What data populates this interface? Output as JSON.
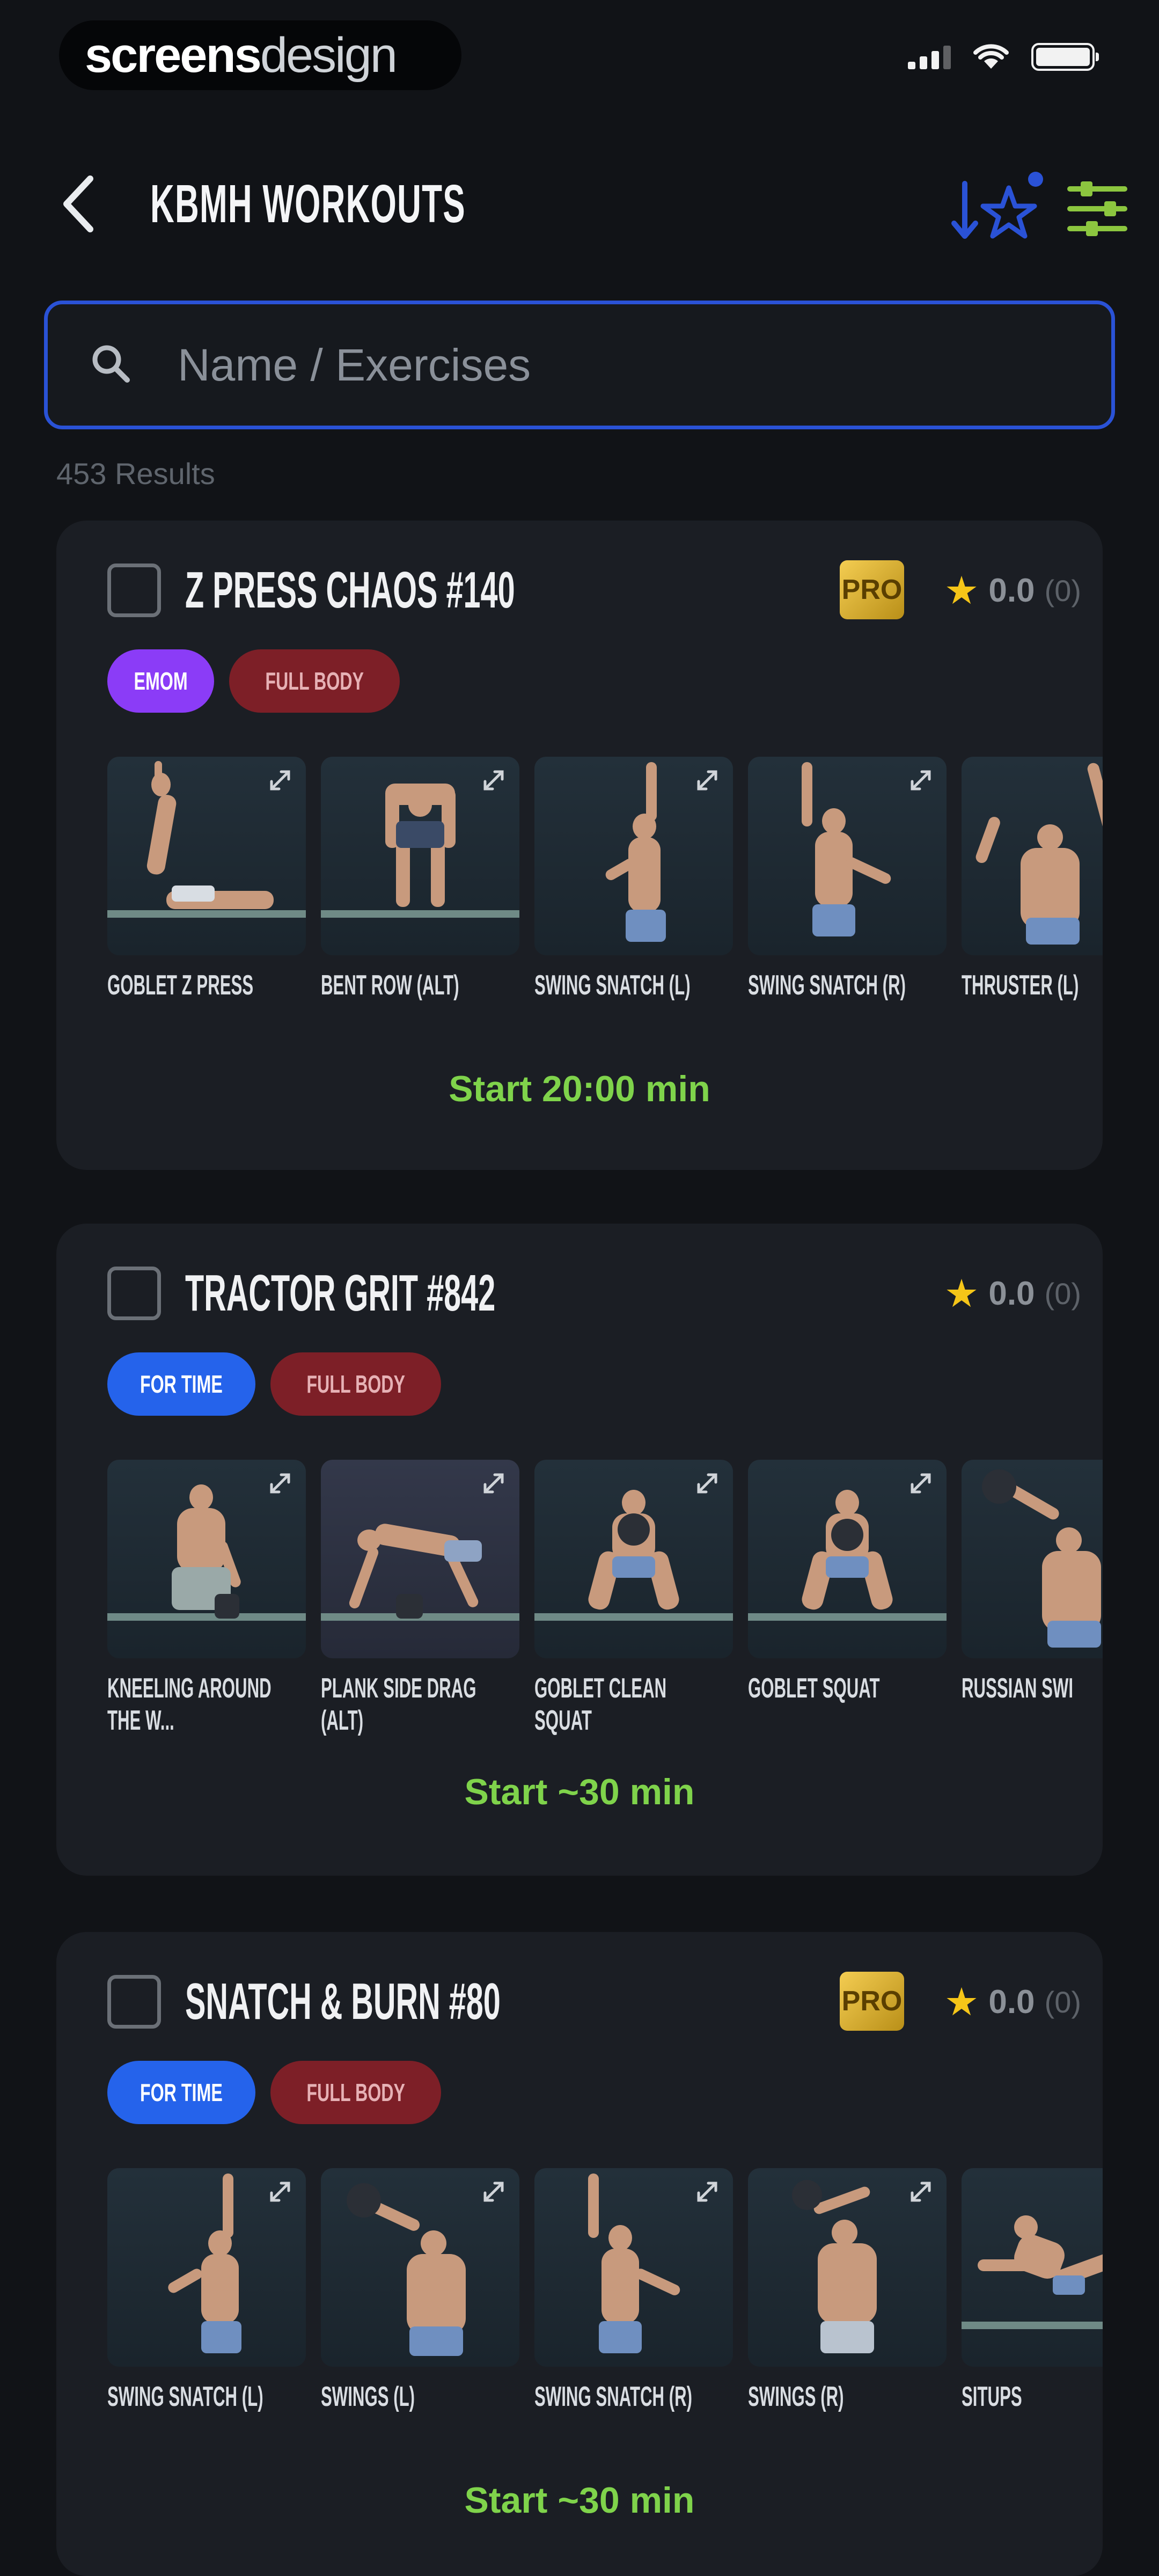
{
  "status_bar": {
    "brand_bold": "screens",
    "brand_light": "design"
  },
  "header": {
    "title": "KBMH WORKOUTS",
    "back_icon": "chevron-left-icon",
    "favorites_icon": "star-sort-icon",
    "filter_icon": "sliders-icon",
    "accent_color": "#2a52d6",
    "filter_color": "#8cc63f"
  },
  "search": {
    "placeholder": "Name / Exercises",
    "value": "",
    "results_text": "453 Results"
  },
  "cards": [
    {
      "title": "Z PRESS CHAOS #140",
      "pro": true,
      "pro_label": "PRO",
      "rating": "0.0",
      "rating_count": "(0)",
      "tags": [
        "EMOM",
        "FULL BODY"
      ],
      "exercises": [
        "GOBLET Z PRESS",
        "BENT ROW (ALT)",
        "SWING SNATCH (L)",
        "SWING SNATCH (R)",
        "THRUSTER (L)"
      ],
      "start": "Start 20:00 min"
    },
    {
      "title": "TRACTOR GRIT #842",
      "pro": false,
      "pro_label": "",
      "rating": "0.0",
      "rating_count": "(0)",
      "tags": [
        "FOR TIME",
        "FULL BODY"
      ],
      "exercises": [
        "KNEELING AROUND THE W...",
        "PLANK SIDE DRAG (ALT)",
        "GOBLET CLEAN SQUAT",
        "GOBLET SQUAT",
        "RUSSIAN SWI"
      ],
      "start": "Start ~30 min"
    },
    {
      "title": "SNATCH & BURN #80",
      "pro": true,
      "pro_label": "PRO",
      "rating": "0.0",
      "rating_count": "(0)",
      "tags": [
        "FOR TIME",
        "FULL BODY"
      ],
      "exercises": [
        "SWING SNATCH (L)",
        "SWINGS (L)",
        "SWING SNATCH (R)",
        "SWINGS (R)",
        "SITUPS"
      ],
      "start": "Start ~30 min"
    }
  ]
}
